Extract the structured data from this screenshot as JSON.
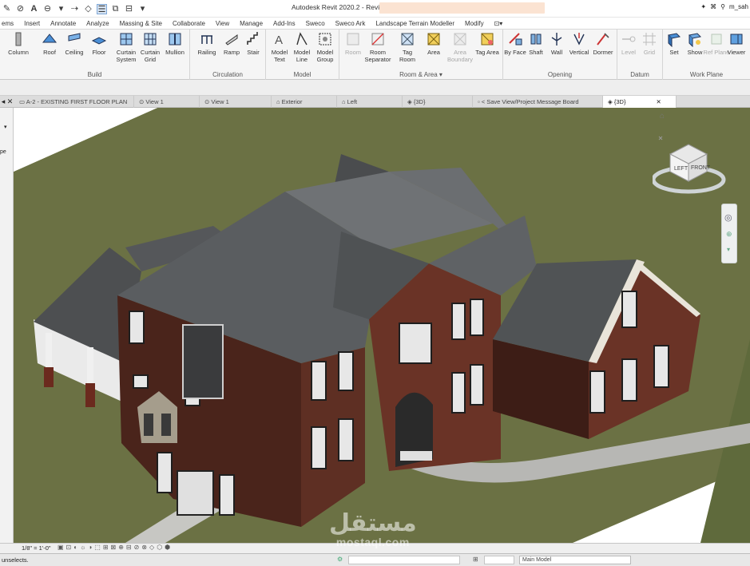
{
  "window": {
    "title": "Autodesk Revit 2020.2 - Revit",
    "user": "m_sah"
  },
  "ribbon_tabs": [
    "ems",
    "Insert",
    "Annotate",
    "Analyze",
    "Massing & Site",
    "Collaborate",
    "View",
    "Manage",
    "Add-Ins",
    "Sweco",
    "Sweco Ark",
    "Landscape Terrain Modeller",
    "Modify"
  ],
  "panels": {
    "build": {
      "label": "Build",
      "tools": [
        {
          "label": "Column",
          "icon": "column-icon"
        },
        {
          "label": "Roof",
          "icon": "roof-icon"
        },
        {
          "label": "Ceiling",
          "icon": "ceiling-icon"
        },
        {
          "label": "Floor",
          "icon": "floor-icon"
        },
        {
          "label": "Curtain System",
          "icon": "curtain-system-icon"
        },
        {
          "label": "Curtain Grid",
          "icon": "curtain-grid-icon"
        },
        {
          "label": "Mullion",
          "icon": "mullion-icon"
        }
      ]
    },
    "circulation": {
      "label": "Circulation",
      "tools": [
        {
          "label": "Railing",
          "icon": "railing-icon"
        },
        {
          "label": "Ramp",
          "icon": "ramp-icon"
        },
        {
          "label": "Stair",
          "icon": "stair-icon"
        }
      ]
    },
    "model": {
      "label": "Model",
      "tools": [
        {
          "label": "Model Text",
          "icon": "model-text-icon"
        },
        {
          "label": "Model Line",
          "icon": "model-line-icon"
        },
        {
          "label": "Model Group",
          "icon": "model-group-icon"
        }
      ]
    },
    "room_area": {
      "label": "Room & Area",
      "tools": [
        {
          "label": "Room",
          "icon": "room-icon",
          "dim": true
        },
        {
          "label": "Room Separator",
          "icon": "room-separator-icon"
        },
        {
          "label": "Tag Room",
          "icon": "tag-room-icon"
        },
        {
          "label": "Area",
          "icon": "area-icon"
        },
        {
          "label": "Area Boundary",
          "icon": "area-boundary-icon",
          "dim": true
        },
        {
          "label": "Tag Area",
          "icon": "tag-area-icon"
        }
      ]
    },
    "opening": {
      "label": "Opening",
      "tools": [
        {
          "label": "By Face",
          "icon": "by-face-icon"
        },
        {
          "label": "Shaft",
          "icon": "shaft-icon"
        },
        {
          "label": "Wall",
          "icon": "wall-opening-icon"
        },
        {
          "label": "Vertical",
          "icon": "vertical-icon"
        },
        {
          "label": "Dormer",
          "icon": "dormer-icon"
        }
      ]
    },
    "datum": {
      "label": "Datum",
      "tools": [
        {
          "label": "Level",
          "icon": "level-icon",
          "dim": true
        },
        {
          "label": "Grid",
          "icon": "grid-icon",
          "dim": true
        }
      ]
    },
    "work_plane": {
      "label": "Work Plane",
      "tools": [
        {
          "label": "Set",
          "icon": "set-icon"
        },
        {
          "label": "Show",
          "icon": "show-icon"
        },
        {
          "label": "Ref Plane",
          "icon": "ref-plane-icon",
          "dim": true
        },
        {
          "label": "Viewer",
          "icon": "viewer-icon"
        }
      ]
    }
  },
  "view_tabs": [
    {
      "label": "A-2 - EXISTING FIRST FLOOR PLAN",
      "icon": "floor-plan-icon"
    },
    {
      "label": "View 1",
      "icon": "camera-icon"
    },
    {
      "label": "View 1",
      "icon": "camera-icon"
    },
    {
      "label": "Exterior",
      "icon": "elevation-icon"
    },
    {
      "label": "Left",
      "icon": "elevation-icon"
    },
    {
      "label": "{3D}",
      "icon": "3d-icon"
    },
    {
      "label": "< Save View/Project Message Board",
      "icon": "sheet-icon"
    },
    {
      "label": "{3D}",
      "icon": "3d-icon",
      "active": true
    }
  ],
  "viewcube": {
    "left_face": "LEFT",
    "front_face": "FRONT"
  },
  "view_control": {
    "scale": "1/8\" = 1'-0\""
  },
  "status": {
    "message": "unselects.",
    "model": "Main Model"
  },
  "watermark": {
    "arabic": "مستقل",
    "latin": "mostaql.com"
  },
  "colors": {
    "grass": "#6b7144",
    "roof": "#5f6264",
    "brick": "#5a2e22",
    "paving": "#a9a9a6"
  }
}
